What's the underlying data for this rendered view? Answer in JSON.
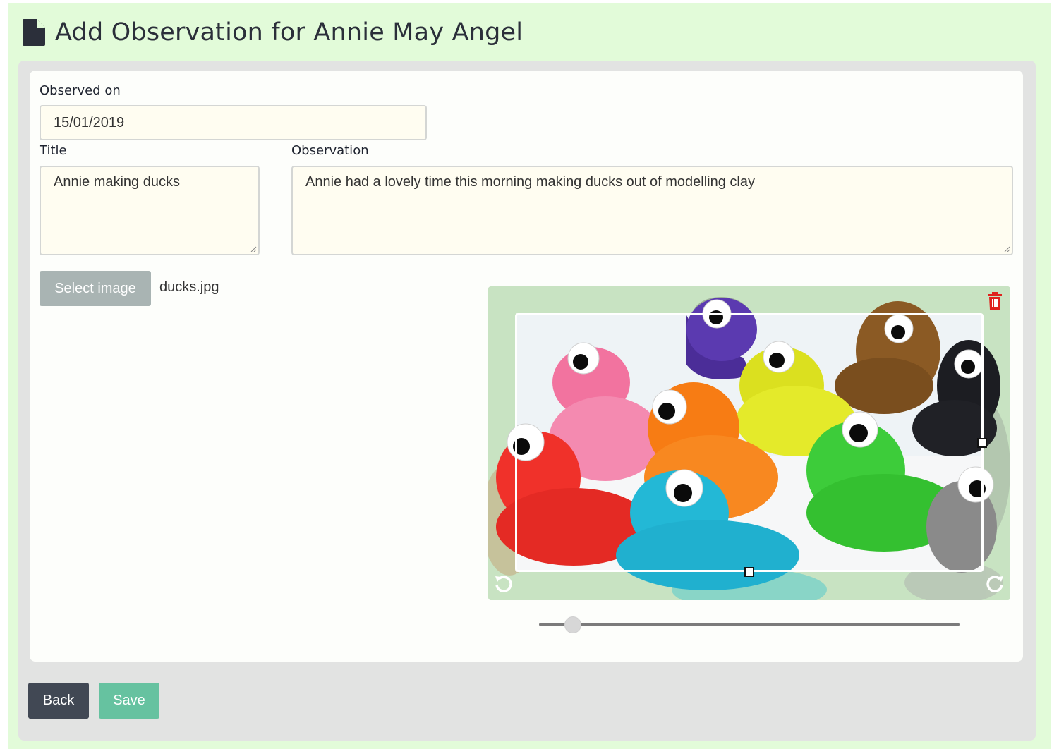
{
  "page": {
    "title": "Add Observation for Annie May Angel",
    "icon": "file-icon"
  },
  "form": {
    "observed_on_label": "Observed on",
    "observed_on_value": "15/01/2019",
    "title_label": "Title",
    "title_value": "Annie making ducks",
    "observation_label": "Observation",
    "observation_value": "Annie had a lovely time this morning making ducks out of modelling clay",
    "select_image_label": "Select image",
    "selected_file": "ducks.jpg"
  },
  "cropper": {
    "delete_icon": "trash-icon",
    "rotate_left_icon": "rotate-left-icon",
    "rotate_right_icon": "rotate-right-icon",
    "zoom_level": 0.08
  },
  "actions": {
    "back_label": "Back",
    "save_label": "Save"
  },
  "colors": {
    "page_background": "#e2fbd9",
    "card_outer": "#e2e3e2",
    "input_background": "#fffdf1",
    "select_button": "#a9b4b3",
    "back_button": "#414854",
    "save_button": "#66c2a0",
    "delete_icon": "#e0221d"
  }
}
